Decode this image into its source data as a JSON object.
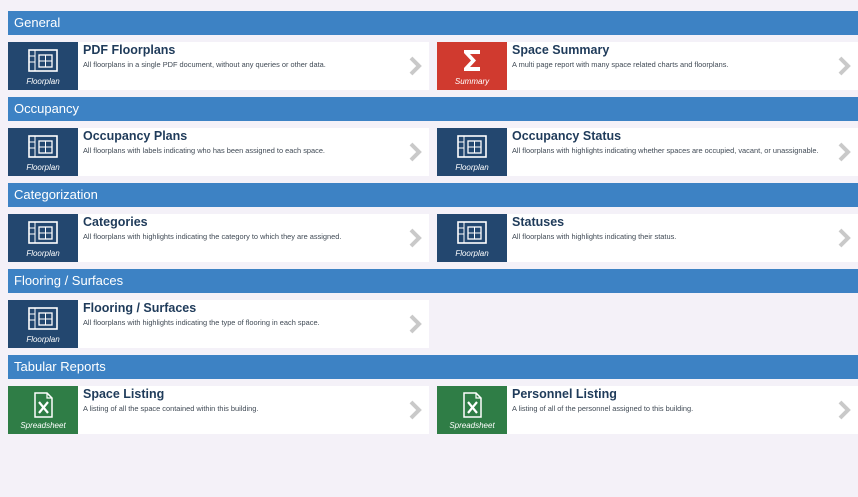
{
  "sections": [
    {
      "title": "General",
      "cards": [
        {
          "title": "PDF Floorplans",
          "desc": "All floorplans in a single PDF document, without any queries or other data.",
          "tile": "Floorplan"
        },
        {
          "title": "Space Summary",
          "desc": "A multi page report with many space related charts and floorplans.",
          "tile": "Summary"
        }
      ]
    },
    {
      "title": "Occupancy",
      "cards": [
        {
          "title": "Occupancy Plans",
          "desc": "All floorplans with labels indicating who has been assigned to each space.",
          "tile": "Floorplan"
        },
        {
          "title": "Occupancy Status",
          "desc": "All floorplans with highlights indicating whether spaces are occupied, vacant, or unassignable.",
          "tile": "Floorplan"
        }
      ]
    },
    {
      "title": "Categorization",
      "cards": [
        {
          "title": "Categories",
          "desc": "All floorplans with highlights indicating the category to which they are assigned.",
          "tile": "Floorplan"
        },
        {
          "title": "Statuses",
          "desc": "All floorplans with highlights indicating their status.",
          "tile": "Floorplan"
        }
      ]
    },
    {
      "title": "Flooring / Surfaces",
      "cards": [
        {
          "title": "Flooring / Surfaces",
          "desc": "All floorplans with highlights indicating the type of flooring in each space.",
          "tile": "Floorplan"
        }
      ]
    },
    {
      "title": "Tabular Reports",
      "cards": [
        {
          "title": "Space Listing",
          "desc": "A listing of all the space contained within this building.",
          "tile": "Spreadsheet"
        },
        {
          "title": "Personnel Listing",
          "desc": "A listing of all of the personnel assigned to this building.",
          "tile": "Spreadsheet"
        }
      ]
    }
  ],
  "colors": {
    "header": "#3d82c4",
    "floorplan_tile": "#23476f",
    "summary_tile": "#d03a2f",
    "spreadsheet_tile": "#2f7d46"
  },
  "icons": {
    "Floorplan": "floorplan-icon",
    "Summary": "sigma-icon",
    "Spreadsheet": "excel-icon"
  }
}
